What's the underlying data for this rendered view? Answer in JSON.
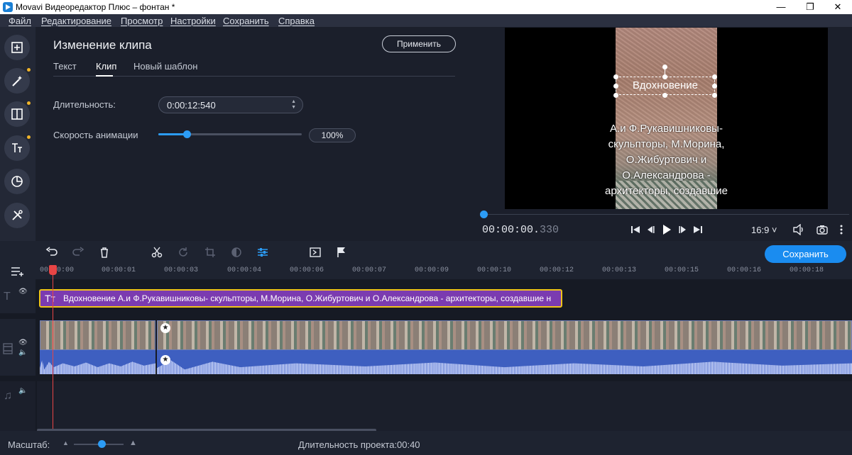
{
  "window": {
    "title": "Movavi Видеоредактор Плюс – фонтан *",
    "controls": [
      "—",
      "❐",
      "✕"
    ]
  },
  "menu": [
    "Файл",
    "Редактирование",
    "Просмотр",
    "Настройки",
    "Сохранить",
    "Справка"
  ],
  "sidebar": {
    "items": [
      {
        "name": "import-icon"
      },
      {
        "name": "magic-wand-icon"
      },
      {
        "name": "transitions-icon"
      },
      {
        "name": "titles-icon"
      },
      {
        "name": "stickers-icon"
      },
      {
        "name": "tools-icon"
      }
    ],
    "accent": "#f0b429"
  },
  "editor": {
    "title": "Изменение клипа",
    "apply_label": "Применить",
    "tabs": [
      "Текст",
      "Клип",
      "Новый шаблон"
    ],
    "active_tab": "Клип",
    "duration_label": "Длительность:",
    "duration_value": "0:00:12:540",
    "speed_label": "Скорость анимации",
    "speed_value": "100%",
    "speed_fraction": 0.2
  },
  "preview": {
    "title_text": "Вдохновение",
    "body_text": "А.и Ф.Рукавишниковы- скульпторы, М.Морина, О.Жибуртович и О.Александрова - архитекторы, создавшие",
    "timecode_main": "00:00:00.",
    "timecode_ms": "330",
    "aspect": "16:9 ˅"
  },
  "toolbar": {
    "save_label": "Сохранить",
    "accent": "#1a8cf0"
  },
  "ruler": {
    "ticks": [
      "00:00:00",
      "00:00:01",
      "00:00:03",
      "00:00:04",
      "00:00:06",
      "00:00:07",
      "00:00:09",
      "00:00:10",
      "00:00:12",
      "00:00:13",
      "00:00:15",
      "00:00:16",
      "00:00:18"
    ]
  },
  "timeline": {
    "text_clip": "Вдохновение А.и Ф.Рукавишниковы- скульпторы, М.Морина, О.Жибуртович и О.Александрова - архитекторы, создавшие н",
    "text_clip_icon": "Tт",
    "playhead_color": "#e84545"
  },
  "status": {
    "zoom_label": "Масштаб:",
    "zoom_fraction": 0.55,
    "duration_label": "Длительность проекта:",
    "duration_value": "00:40"
  }
}
